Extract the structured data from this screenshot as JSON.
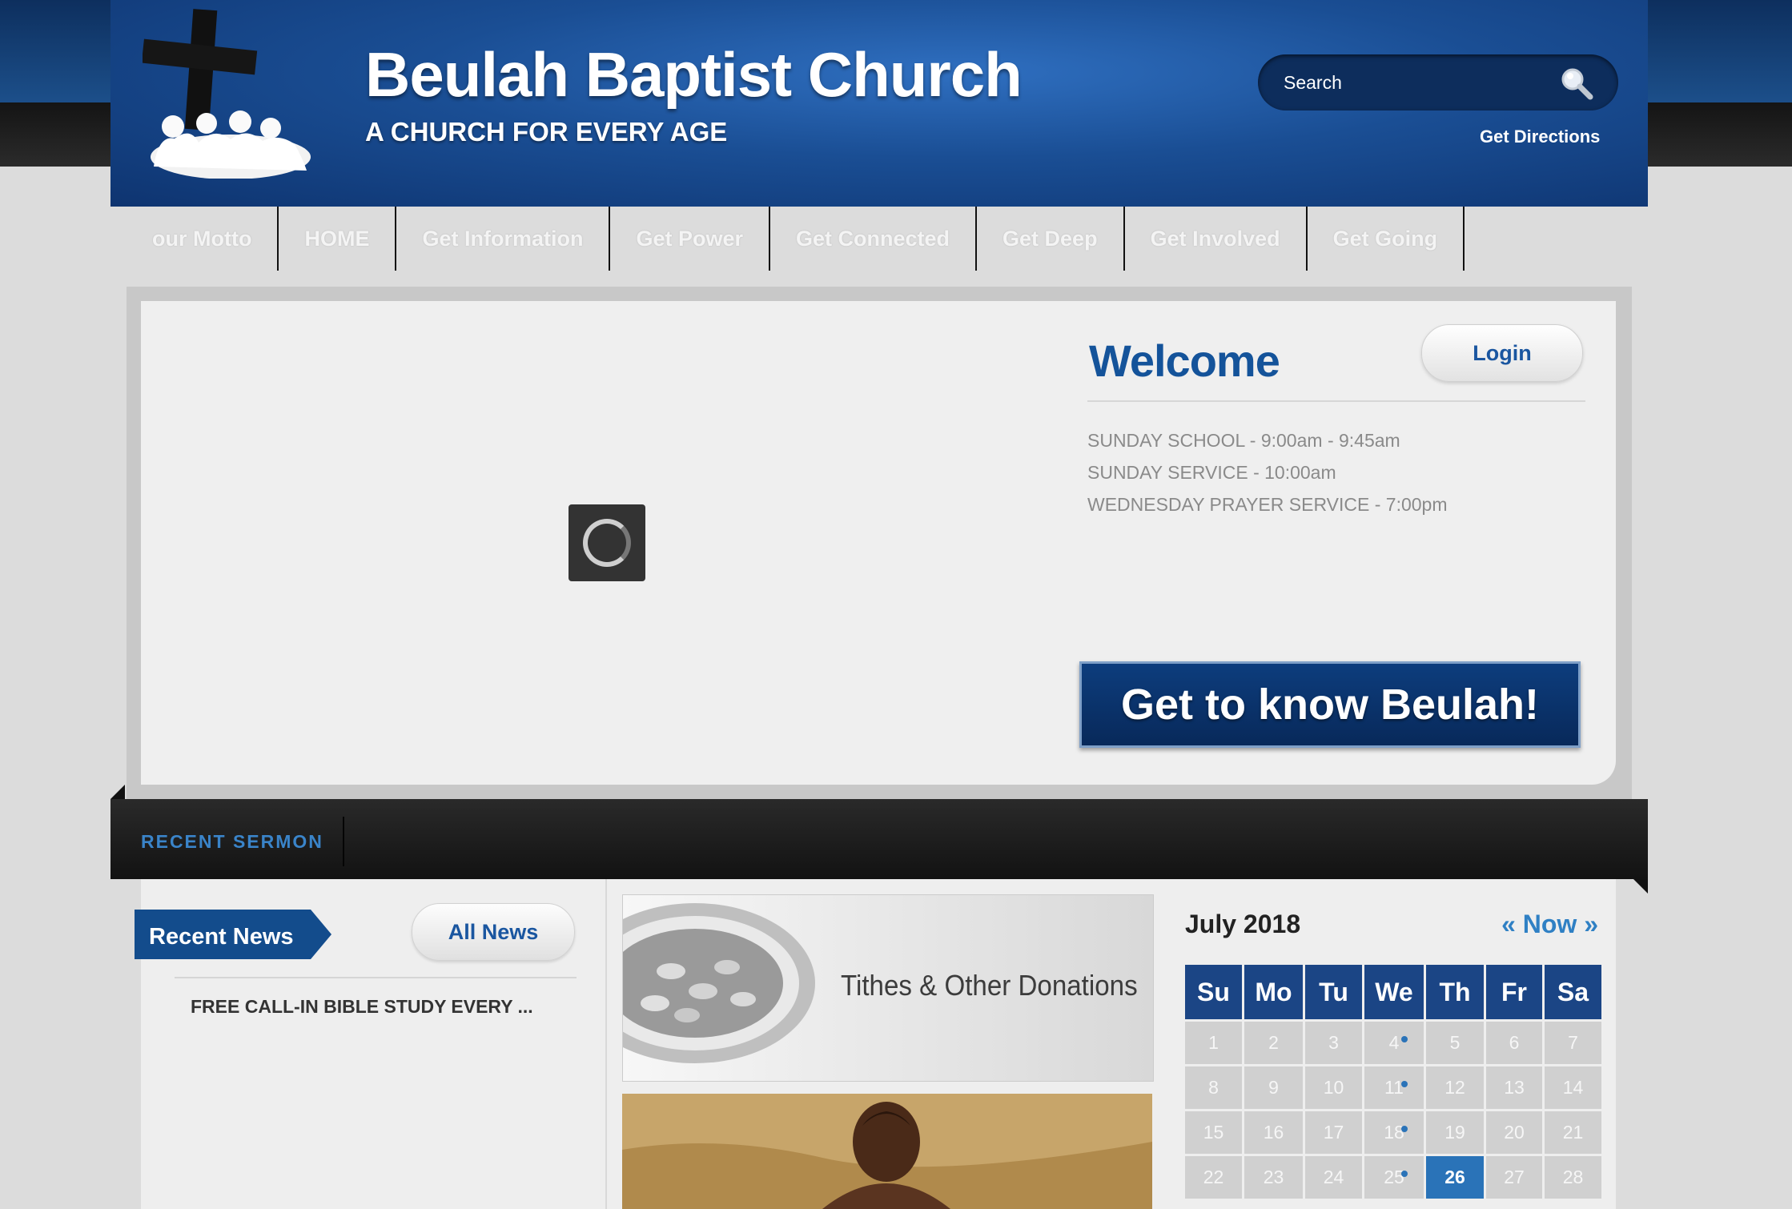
{
  "header": {
    "title": "Beulah Baptist Church",
    "tagline": "A CHURCH FOR EVERY AGE",
    "search_placeholder": "Search",
    "directions_label": "Get Directions"
  },
  "nav": {
    "items": [
      "our Motto",
      "HOME",
      "Get Information",
      "Get Power",
      "Get Connected",
      "Get Deep",
      "Get Involved",
      "Get Going"
    ]
  },
  "welcome": {
    "heading": "Welcome",
    "login_label": "Login",
    "services": [
      "SUNDAY SCHOOL - 9:00am - 9:45am",
      "SUNDAY SERVICE - 10:00am",
      "WEDNESDAY PRAYER SERVICE  - 7:00pm"
    ],
    "cta_label": "Get to know Beulah!"
  },
  "sermon": {
    "label": "RECENT SERMON"
  },
  "news": {
    "badge_label": "Recent News",
    "all_label": "All News",
    "items": [
      "FREE CALL-IN BIBLE STUDY EVERY ..."
    ]
  },
  "promos": {
    "tithes_title": "Tithes & Other Donations"
  },
  "calendar": {
    "month": "July 2018",
    "nav_label": "« Now »",
    "weekdays": [
      "Su",
      "Mo",
      "Tu",
      "We",
      "Th",
      "Fr",
      "Sa"
    ],
    "weeks": [
      [
        "1",
        "2",
        "3",
        "4",
        "5",
        "6",
        "7"
      ],
      [
        "8",
        "9",
        "10",
        "11",
        "12",
        "13",
        "14"
      ],
      [
        "15",
        "16",
        "17",
        "18",
        "19",
        "20",
        "21"
      ],
      [
        "22",
        "23",
        "24",
        "25",
        "26",
        "27",
        "28"
      ]
    ],
    "event_days": [
      "4",
      "11",
      "18",
      "25"
    ],
    "today": "26"
  },
  "colors": {
    "brand_blue": "#1a56a0",
    "header_blue": "#1a4e94",
    "calendar_header": "#1b4585",
    "accent": "#2f80c4"
  }
}
